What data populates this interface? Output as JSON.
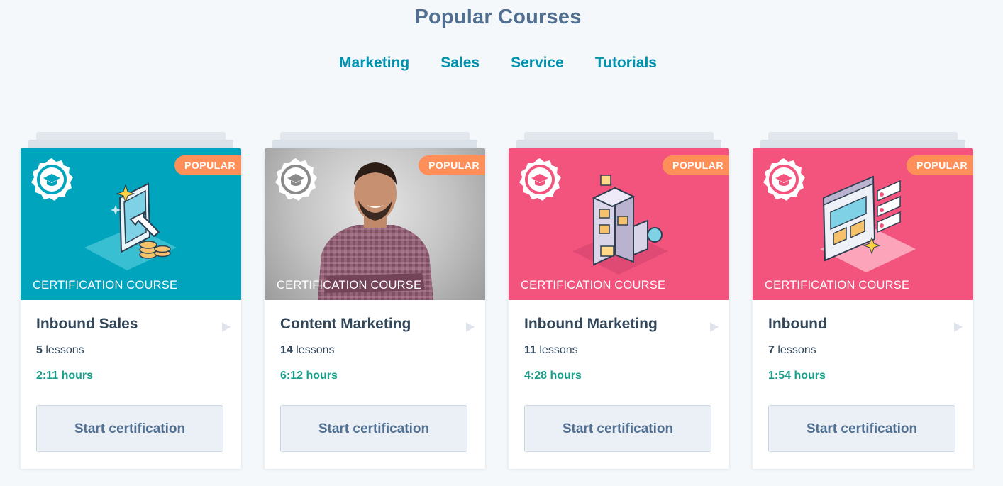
{
  "page": {
    "title": "Popular Courses"
  },
  "tabs": [
    {
      "label": "Marketing"
    },
    {
      "label": "Sales"
    },
    {
      "label": "Service"
    },
    {
      "label": "Tutorials"
    }
  ],
  "colors": {
    "teal": "#00a4bd",
    "pink": "#f2547d",
    "popular": "#ff8f59",
    "hours": "#1a9e8a"
  },
  "courses": [
    {
      "badge": "POPULAR",
      "category": "CERTIFICATION COURSE",
      "title": "Inbound Sales",
      "lessons_count": "5",
      "lessons_word": "lessons",
      "hours": "2:11 hours",
      "button": "Start certification",
      "theme": "teal"
    },
    {
      "badge": "POPULAR",
      "category": "CERTIFICATION COURSE",
      "title": "Content Marketing",
      "lessons_count": "14",
      "lessons_word": "lessons",
      "hours": "6:12 hours",
      "button": "Start certification",
      "theme": "photo"
    },
    {
      "badge": "POPULAR",
      "category": "CERTIFICATION COURSE",
      "title": "Inbound Marketing",
      "lessons_count": "11",
      "lessons_word": "lessons",
      "hours": "4:28 hours",
      "button": "Start certification",
      "theme": "pink"
    },
    {
      "badge": "POPULAR",
      "category": "CERTIFICATION COURSE",
      "title": "Inbound",
      "lessons_count": "7",
      "lessons_word": "lessons",
      "hours": "1:54 hours",
      "button": "Start certification",
      "theme": "pink"
    }
  ]
}
